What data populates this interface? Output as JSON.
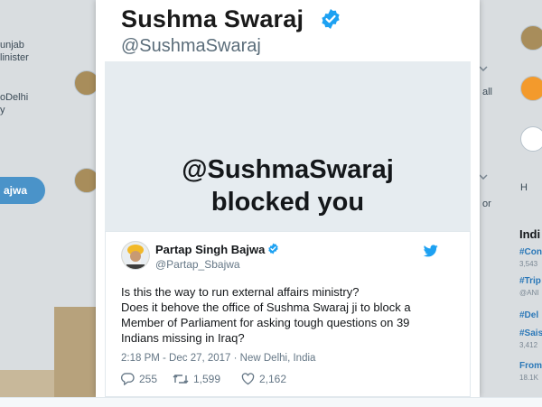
{
  "background": {
    "left_texts": [
      "unjab",
      "linister",
      "oDelhi",
      "y"
    ],
    "left_button_label": "ajwa",
    "right_texts": [
      "all",
      "or",
      "H"
    ],
    "trends_heading": "Indi",
    "trends": [
      {
        "tag": "#Con",
        "sub": "3,543"
      },
      {
        "tag": "#Trip",
        "sub": "@ANI"
      },
      {
        "tag": "#Del",
        "sub": ""
      },
      {
        "tag": "#Sais",
        "sub": "3,412"
      },
      {
        "tag": "From",
        "sub": "18.1K"
      }
    ]
  },
  "card": {
    "title": "Sushma Swaraj",
    "handle": "@SushmaSwaraj",
    "blocked_line1": "@SushmaSwaraj",
    "blocked_line2": "blocked you"
  },
  "tweet": {
    "name": "Partap Singh Bajwa",
    "handle": "@Partap_Sbajwa",
    "body_lines": [
      "Is this the way to run external affairs ministry?",
      "Does it behove the office of Sushma Swaraj ji to block a",
      "Member of Parliament for asking tough questions on 39",
      "Indians missing in Iraq?"
    ],
    "meta": "2:18 PM - Dec 27, 2017 · New Delhi, India",
    "replies": "255",
    "retweets": "1,599",
    "likes": "2,162"
  },
  "colors": {
    "twitter_blue": "#1da1f2",
    "grey_panel": "#e6ecf0",
    "muted_text": "#657786"
  }
}
